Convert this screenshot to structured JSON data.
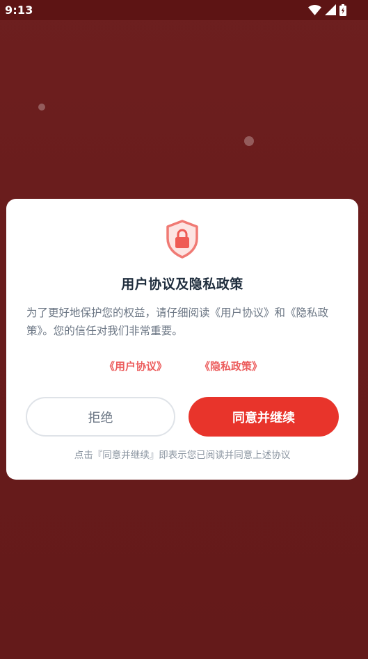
{
  "status_bar": {
    "time": "9:13",
    "icons": [
      "wifi-icon",
      "signal-icon",
      "battery-charging-icon"
    ]
  },
  "dialog": {
    "icon": "shield-lock-icon",
    "title": "用户协议及隐私政策",
    "description": "为了更好地保护您的权益，请仔细阅读《用户协议》和《隐私政策》。您的信任对我们非常重要。",
    "links": {
      "user_agreement": "《用户协议》",
      "privacy_policy": "《隐私政策》"
    },
    "buttons": {
      "reject": "拒绝",
      "agree": "同意并继续"
    },
    "footnote": "点击『同意并继续』即表示您已阅读并同意上述协议"
  },
  "colors": {
    "background": "#6a1d1d",
    "accent": "#e8342b",
    "link": "#ec5d5d",
    "title": "#1f2d3d",
    "body_text": "#6b7684"
  }
}
